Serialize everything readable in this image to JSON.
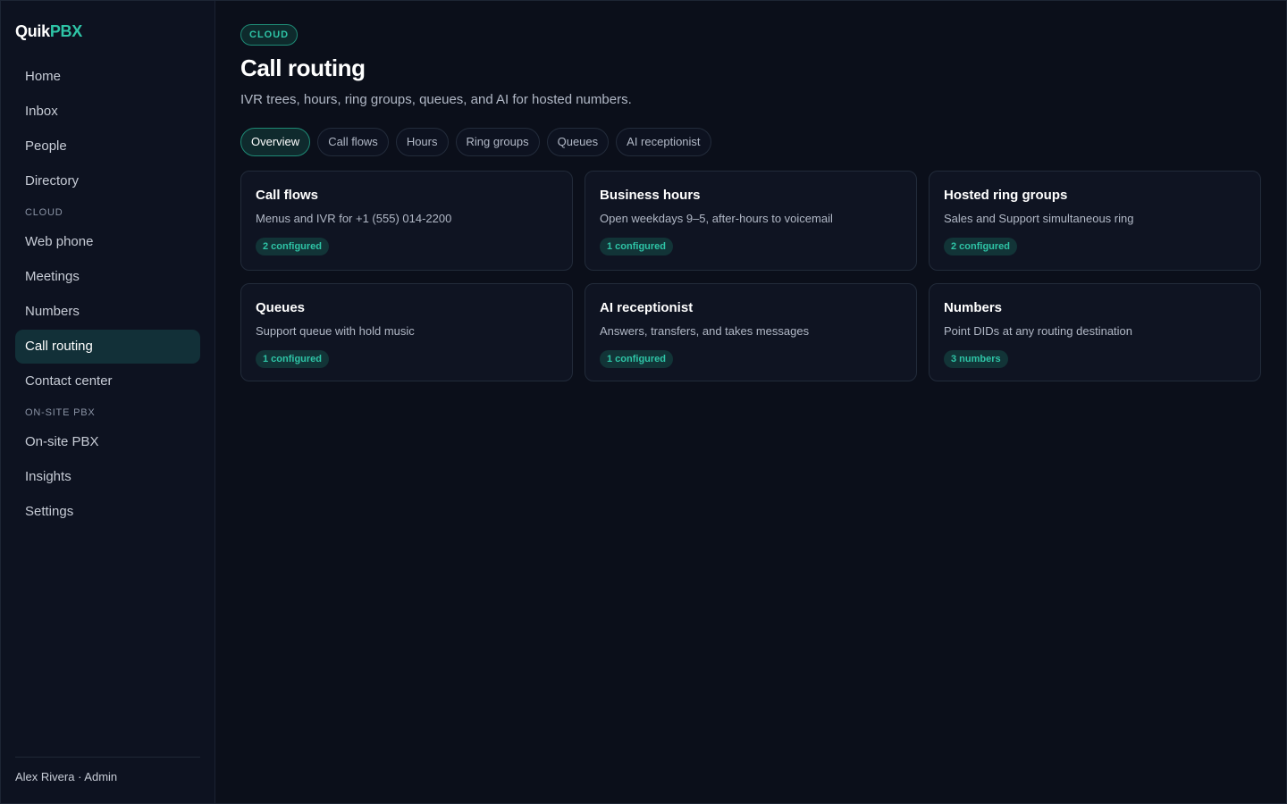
{
  "brand": {
    "part1": "Quik",
    "part2": "PBX"
  },
  "sidebar": {
    "items_top": [
      {
        "label": "Home"
      },
      {
        "label": "Inbox"
      },
      {
        "label": "People"
      },
      {
        "label": "Directory"
      }
    ],
    "section_cloud": "CLOUD",
    "items_cloud": [
      {
        "label": "Web phone"
      },
      {
        "label": "Meetings"
      },
      {
        "label": "Numbers"
      },
      {
        "label": "Call routing"
      },
      {
        "label": "Contact center"
      }
    ],
    "section_onsite": "ON-SITE PBX",
    "items_onsite": [
      {
        "label": "On-site PBX"
      },
      {
        "label": "Insights"
      },
      {
        "label": "Settings"
      }
    ],
    "footer": "Alex Rivera · Admin"
  },
  "header": {
    "badge": "CLOUD",
    "title": "Call routing",
    "subtitle": "IVR trees, hours, ring groups, queues, and AI for hosted numbers."
  },
  "tabs": [
    {
      "label": "Overview"
    },
    {
      "label": "Call flows"
    },
    {
      "label": "Hours"
    },
    {
      "label": "Ring groups"
    },
    {
      "label": "Queues"
    },
    {
      "label": "AI receptionist"
    }
  ],
  "cards": [
    {
      "title": "Call flows",
      "desc": "Menus and IVR for +1 (555) 014-2200",
      "badge": "2 configured"
    },
    {
      "title": "Business hours",
      "desc": "Open weekdays 9–5, after-hours to voicemail",
      "badge": "1 configured"
    },
    {
      "title": "Hosted ring groups",
      "desc": "Sales and Support simultaneous ring",
      "badge": "2 configured"
    },
    {
      "title": "Queues",
      "desc": "Support queue with hold music",
      "badge": "1 configured"
    },
    {
      "title": "AI receptionist",
      "desc": "Answers, transfers, and takes messages",
      "badge": "1 configured"
    },
    {
      "title": "Numbers",
      "desc": "Point DIDs at any routing destination",
      "badge": "3 numbers"
    }
  ],
  "colors": {
    "accent": "#2ec4a6",
    "background": "#0b0f1a",
    "active_nav": "#123038"
  }
}
